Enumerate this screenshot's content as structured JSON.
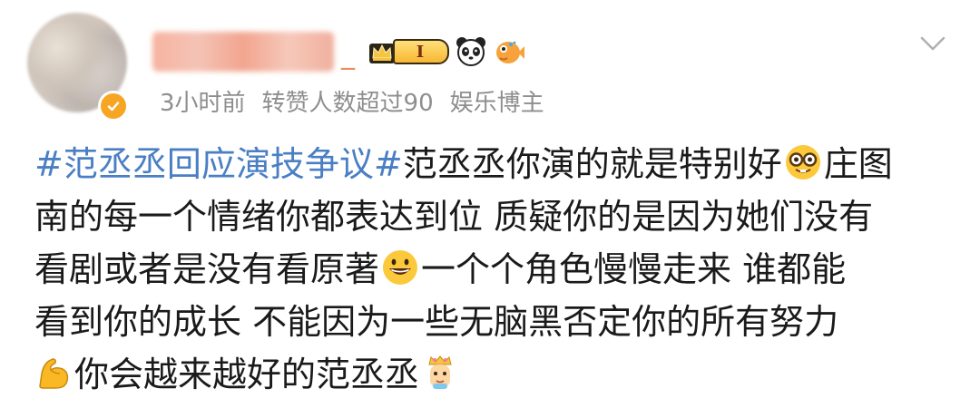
{
  "header": {
    "name_suffix": "_",
    "level_badge": "I",
    "meta": {
      "time_ago": "3小时前",
      "repost_stat": "转赞人数超过90",
      "user_type": "娱乐博主"
    },
    "icons": [
      "crown-icon",
      "panda-icon",
      "pufferfish-icon",
      "chevron-down-icon",
      "verified-badge-icon"
    ]
  },
  "post": {
    "line1": {
      "hashtag": "#范丞丞回应演技争议#",
      "text": "范丞丞你演的就是特别好",
      "emoji": "nerd-face-emoji",
      "tail": "庄图"
    },
    "line2": "南的每一个情绪你都表达到位 质疑你的是因为她们没有",
    "line3": {
      "text": "看剧或者是没有看原著",
      "emoji": "grinning-face-emoji",
      "tail": "一个个角色慢慢走来 谁都能"
    },
    "line4": "看到你的成长 不能因为一些无脑黑否定你的所有努力",
    "line5": {
      "emoji": "flexed-biceps-emoji",
      "text": "你会越来越好的范丞丞",
      "end_emoji": "crowned-face-emoji"
    }
  },
  "colors": {
    "hashtag": "#4a7fc4",
    "meta_text": "#8e8e8e",
    "name": "#f08a5d",
    "verify_badge": "#f6a623"
  }
}
